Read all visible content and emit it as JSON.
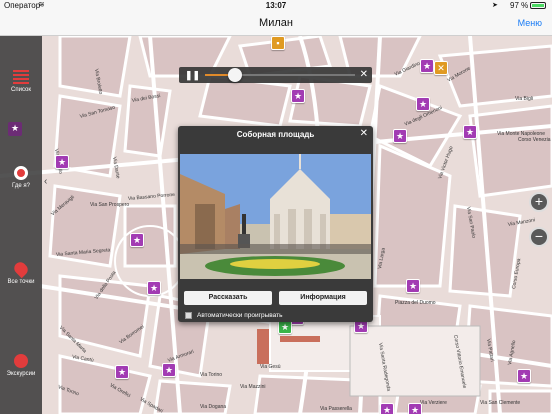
{
  "status": {
    "carrier": "Оператор",
    "time": "13:07",
    "battery_pct": "97 %"
  },
  "nav": {
    "title": "Милан",
    "menu_label": "Меню"
  },
  "sidebar": {
    "list_label": "Список",
    "where_label": "Где я?",
    "all_points_label": "Все точки",
    "tours_label": "Экскурсии"
  },
  "player": {
    "progress_fraction": 0.2
  },
  "popup": {
    "title": "Соборная площадь",
    "tell_button": "Рассказать",
    "info_button": "Информация",
    "autoplay_label": "Автоматически проигрывать"
  },
  "map_labels": {
    "via_dei_bossi": "Via dei Bossi",
    "via_san_tomaso": "Via San Tomaso",
    "via_broletto": "Via Broletto",
    "via_rovello": "Via Rovello",
    "via_dante": "Via Dante",
    "via_bassano_porrone": "Via Bassano Porrone",
    "via_san_prospero": "Via San Prospero",
    "via_santa_maria_segreta": "Via Santa Maria Segreta",
    "via_meravigli": "Via Meravigli",
    "via_santa_marta": "Via Santa Marta",
    "via_morone": "Via Morone",
    "via_giardino": "Via Giardino",
    "via_bigli": "Via Bigli",
    "via_degli_omenoni": "Via degli Omenoni",
    "via_monte_napoleone": "Via Monte Napoleone",
    "corso_vittorio_emanuele": "Corso Vittorio Emanuele",
    "corso_venezia": "Corso Venezia",
    "via_san_paolo": "Via San Paolo",
    "via_victor_hugo": "Via Victor Hugo",
    "via_torino": "Via Torino",
    "piazza_del_duomo": "Piazza del Duomo",
    "via_larga": "Via Larga",
    "via_dogana": "Via Dogana",
    "via_pattari": "Via Pattari",
    "via_santa_radegonda": "Via Santa Radegonda",
    "via_manzoni": "Via Manzoni",
    "corso_europa": "Corso Europa",
    "via_gesu": "Via Gesù",
    "via_agnello": "Via Agnello",
    "via_orefici": "Via Orefici",
    "via_spadari": "Via Spadari",
    "via_cantu": "Via Cantù",
    "via_della_posta": "Via della Posta",
    "via_borromei": "Via Borromei",
    "via_armorari": "Via Armorari",
    "via_torino_2": "Via Torino",
    "via_mazzini": "Via Mazzini",
    "via_verziere": "Via Verziere",
    "via_san_clemente": "Via San Clemente",
    "via_passerella": "Via Passerella"
  },
  "colors": {
    "map_bg": "#e9dcd9",
    "block": "#d9c3c3",
    "poi": "#a23bb3",
    "accent_blue": "#1a7cf5"
  }
}
